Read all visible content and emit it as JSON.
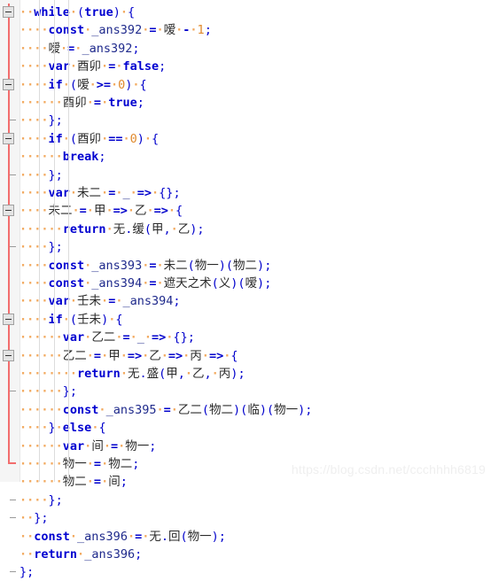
{
  "editor": {
    "background": "#ffffff",
    "gutter_background": "#f5f5f5",
    "fold_rail_color": "#f26d6d",
    "keyword_color": "#0000d0",
    "identifier_color": "#1f2a8c",
    "number_color": "#e08a2e",
    "cjk_color": "#2b2b2b",
    "whitespace_dot_color": "#f2a85c",
    "language": "javascript"
  },
  "watermark": {
    "text": "https://blog.csdn.net/ccchhhh6819"
  },
  "code": {
    "lines": [
      {
        "n": 1,
        "indent": 1,
        "fold": "open",
        "text": "while (true) {"
      },
      {
        "n": 2,
        "indent": 2,
        "fold": "none",
        "text": "const _ans392 = 嗳 - 1;"
      },
      {
        "n": 3,
        "indent": 2,
        "fold": "none",
        "text": "嗳 = _ans392;"
      },
      {
        "n": 4,
        "indent": 2,
        "fold": "none",
        "text": "var 酉卯 = false;"
      },
      {
        "n": 5,
        "indent": 2,
        "fold": "open",
        "text": "if (嗳 >= 0) {"
      },
      {
        "n": 6,
        "indent": 3,
        "fold": "none",
        "text": "酉卯 = true;"
      },
      {
        "n": 7,
        "indent": 2,
        "fold": "end",
        "text": "};"
      },
      {
        "n": 8,
        "indent": 2,
        "fold": "open",
        "text": "if (酉卯 == 0) {"
      },
      {
        "n": 9,
        "indent": 3,
        "fold": "none",
        "text": "break;"
      },
      {
        "n": 10,
        "indent": 2,
        "fold": "end",
        "text": "};"
      },
      {
        "n": 11,
        "indent": 2,
        "fold": "none",
        "text": "var 未二 = _ => {};"
      },
      {
        "n": 12,
        "indent": 2,
        "fold": "open",
        "text": "未二 = 甲 => 乙 => {"
      },
      {
        "n": 13,
        "indent": 3,
        "fold": "none",
        "text": "return 无.缓(甲, 乙);"
      },
      {
        "n": 14,
        "indent": 2,
        "fold": "end",
        "text": "};"
      },
      {
        "n": 15,
        "indent": 2,
        "fold": "none",
        "text": "const _ans393 = 未二(物一)(物二);"
      },
      {
        "n": 16,
        "indent": 2,
        "fold": "none",
        "text": "const _ans394 = 遮天之术(义)(嗳);"
      },
      {
        "n": 17,
        "indent": 2,
        "fold": "none",
        "text": "var 壬未 = _ans394;"
      },
      {
        "n": 18,
        "indent": 2,
        "fold": "open",
        "text": "if (壬未) {"
      },
      {
        "n": 19,
        "indent": 3,
        "fold": "none",
        "text": "var 乙二 = _ => {};"
      },
      {
        "n": 20,
        "indent": 3,
        "fold": "open",
        "text": "乙二 = 甲 => 乙 => 丙 => {"
      },
      {
        "n": 21,
        "indent": 4,
        "fold": "none",
        "text": "return 无.盛(甲, 乙, 丙);"
      },
      {
        "n": 22,
        "indent": 3,
        "fold": "end",
        "text": "};"
      },
      {
        "n": 23,
        "indent": 3,
        "fold": "none",
        "text": "const _ans395 = 乙二(物二)(临)(物一);"
      },
      {
        "n": 24,
        "indent": 2,
        "fold": "none",
        "text": "} else {"
      },
      {
        "n": 25,
        "indent": 3,
        "fold": "none",
        "text": "var 间 = 物一;"
      },
      {
        "n": 26,
        "indent": 3,
        "fold": "none",
        "text": "物一 = 物二;"
      },
      {
        "n": 27,
        "indent": 3,
        "fold": "none",
        "text": "物二 = 间;"
      },
      {
        "n": 28,
        "indent": 2,
        "fold": "end",
        "text": "};"
      },
      {
        "n": 29,
        "indent": 1,
        "fold": "end",
        "text": "};"
      },
      {
        "n": 30,
        "indent": 1,
        "fold": "none",
        "text": "const _ans396 = 无.回(物一);"
      },
      {
        "n": 31,
        "indent": 1,
        "fold": "none",
        "text": "return _ans396;"
      },
      {
        "n": 32,
        "indent": 0,
        "fold": "end",
        "text": "};"
      }
    ],
    "keywords": [
      "while",
      "const",
      "var",
      "if",
      "else",
      "return",
      "break",
      "true",
      "false"
    ]
  }
}
